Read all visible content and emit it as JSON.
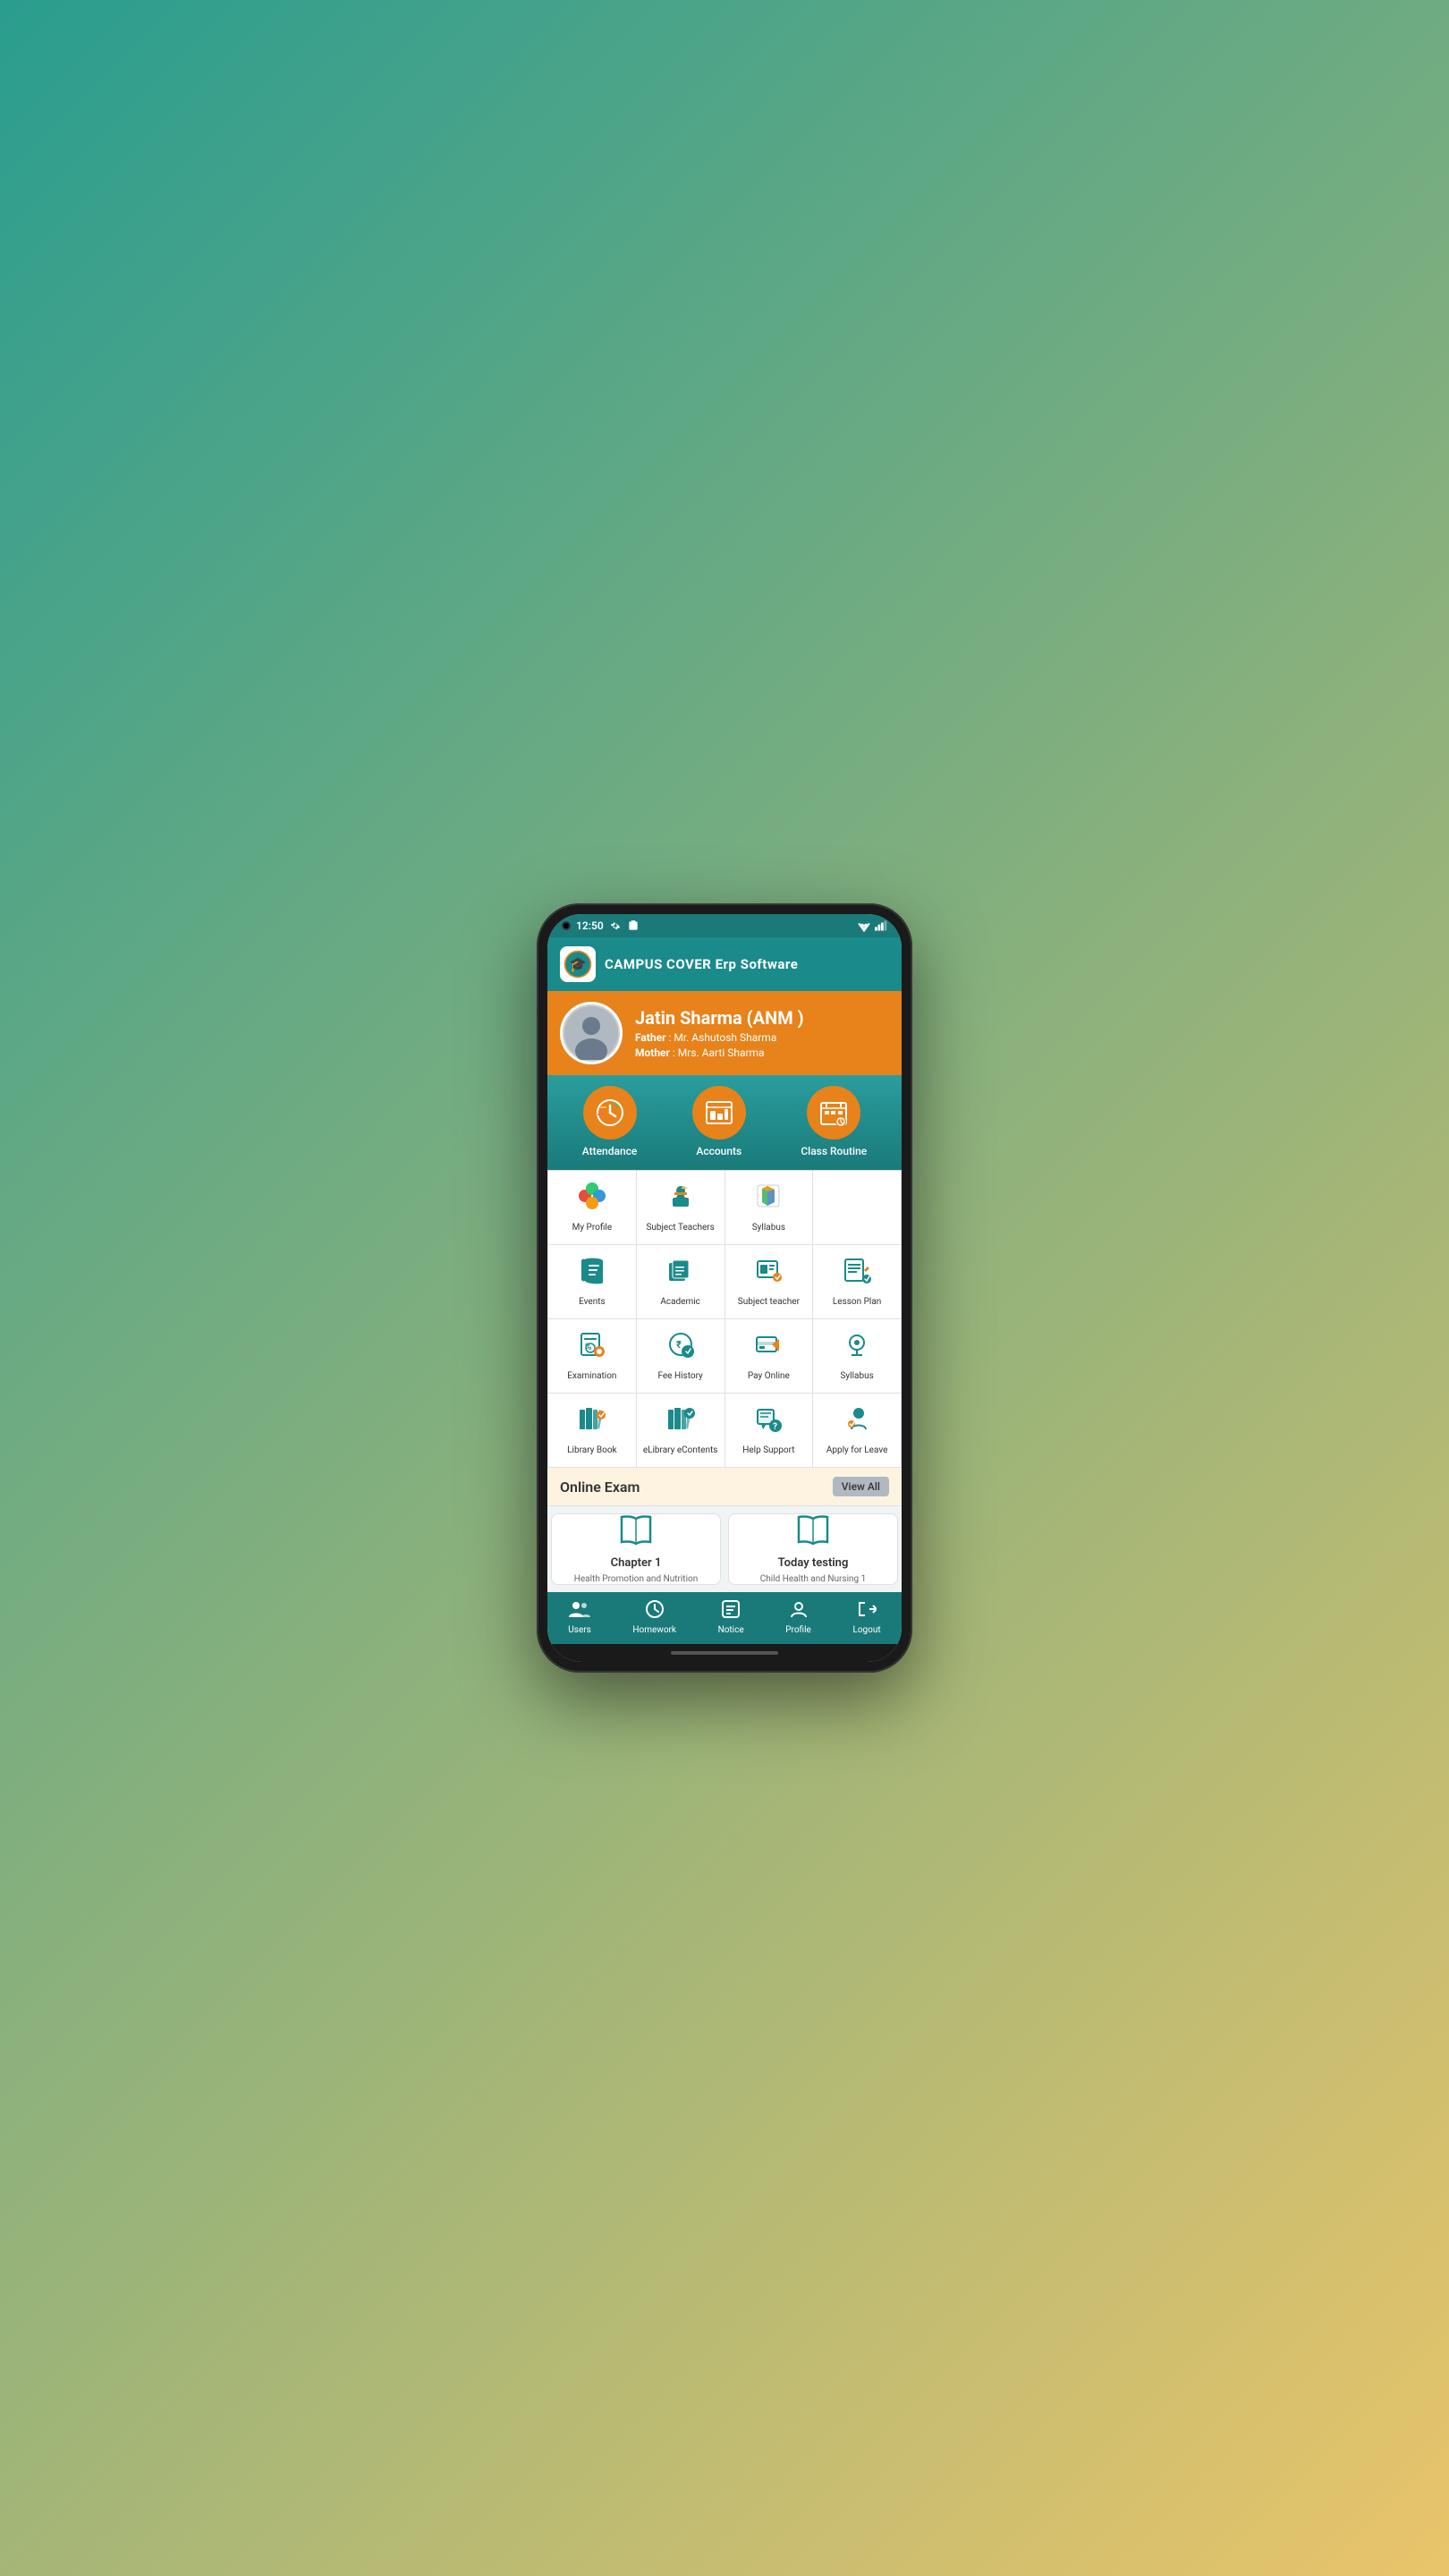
{
  "statusBar": {
    "time": "12:50",
    "settingsIcon": "gear-icon",
    "simIcon": "sim-icon"
  },
  "header": {
    "title": "CAMPUS COVER Erp Software",
    "logoSymbol": "🎓"
  },
  "profile": {
    "name": "Jatin Sharma (ANM )",
    "fatherLabel": "Father",
    "fatherName": "Mr. Ashutosh Sharma",
    "motherLabel": "Mother",
    "motherName": "Mrs. Aarti Sharma"
  },
  "quickStats": [
    {
      "id": "attendance",
      "label": "Attendance",
      "icon": "clock-icon"
    },
    {
      "id": "accounts",
      "label": "Accounts",
      "icon": "chart-icon"
    },
    {
      "id": "classRoutine",
      "label": "Class Routine",
      "icon": "calendar-icon"
    }
  ],
  "menuGrid": [
    {
      "id": "my-profile",
      "label": "My Profile",
      "icon": "profile-color"
    },
    {
      "id": "subject-teachers",
      "label": "Subject Teachers",
      "icon": "teacher"
    },
    {
      "id": "syllabus-1",
      "label": "Syllabus",
      "icon": "syllabus"
    },
    {
      "id": "empty-1",
      "label": "",
      "icon": ""
    },
    {
      "id": "events",
      "label": "Events",
      "icon": "book-open"
    },
    {
      "id": "academic",
      "label": "Academic",
      "icon": "books"
    },
    {
      "id": "subject-teacher",
      "label": "Subject teacher",
      "icon": "subject-teacher"
    },
    {
      "id": "lesson-plan",
      "label": "Lesson Plan",
      "icon": "lesson-plan"
    },
    {
      "id": "examination",
      "label": "Examination",
      "icon": "examination"
    },
    {
      "id": "fee-history",
      "label": "Fee History",
      "icon": "fee-history"
    },
    {
      "id": "pay-online",
      "label": "Pay Online",
      "icon": "pay-online"
    },
    {
      "id": "syllabus-2",
      "label": "Syllabus",
      "icon": "syllabus2"
    },
    {
      "id": "library-book",
      "label": "Library Book",
      "icon": "library"
    },
    {
      "id": "elibrary",
      "label": "eLibrary eContents",
      "icon": "elibrary"
    },
    {
      "id": "help-support",
      "label": "Help Support",
      "icon": "help"
    },
    {
      "id": "apply-leave",
      "label": "Apply for Leave",
      "icon": "leave"
    }
  ],
  "onlineExam": {
    "sectionTitle": "Online Exam",
    "viewAllLabel": "View All",
    "cards": [
      {
        "id": "chapter1",
        "title": "Chapter 1",
        "subtitle": "Health Promotion and Nutrition"
      },
      {
        "id": "today-testing",
        "title": "Today testing",
        "subtitle": "Child Health and Nursing 1"
      }
    ]
  },
  "bottomNav": [
    {
      "id": "users",
      "label": "Users",
      "icon": "users-icon"
    },
    {
      "id": "homework",
      "label": "Homework",
      "icon": "clock-nav-icon"
    },
    {
      "id": "notice",
      "label": "Notice",
      "icon": "notice-icon"
    },
    {
      "id": "profile",
      "label": "Profile",
      "icon": "profile-nav-icon"
    },
    {
      "id": "logout",
      "label": "Logout",
      "icon": "logout-icon"
    }
  ]
}
